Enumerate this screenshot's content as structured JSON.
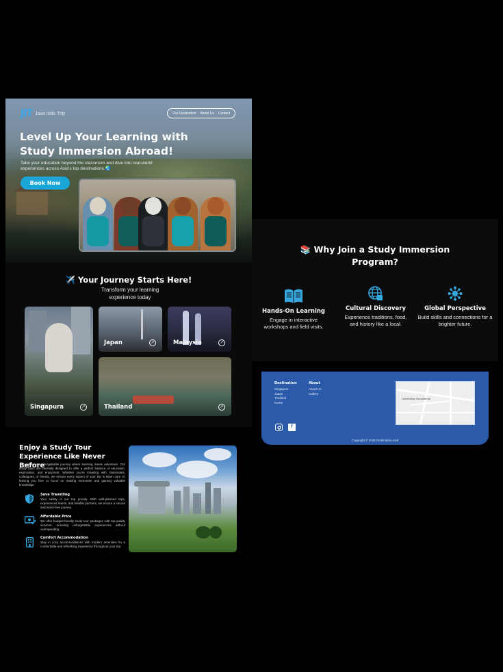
{
  "hero": {
    "logo_mark": "JIT",
    "logo_text": "Java Indo Trip",
    "nav": [
      "Our Destination",
      "About Us",
      "Contact"
    ],
    "title": "Level Up Your Learning with Study Immersion Abroad!",
    "subtitle": "Take your education beyond the classroom and dive into real-world experiences across Asia's top destinations.🌏",
    "cta": "Book Now"
  },
  "journey": {
    "title": "✈️ Your Journey Starts Here!",
    "subtitle": "Transform your learning experience today",
    "destinations": [
      {
        "name": "Singapura",
        "arrow": "↗"
      },
      {
        "name": "Japan",
        "arrow": "↗"
      },
      {
        "name": "Malaysia",
        "arrow": "↗"
      },
      {
        "name": "Thailand",
        "arrow": "↗"
      }
    ]
  },
  "enjoy": {
    "title": "Enjoy a Study Tour Experience Like Never Before",
    "body": "Join us for an unforgettable journey where learning meets adventure. Our study tours are carefully designed to offer a perfect balance of education, exploration, and enjoyment. Whether you're traveling with classmates, colleagues, or friends, we ensure every aspect of your trip is taken care of, leaving you free to focus on making memories and gaining valuable knowledge.",
    "features": [
      {
        "icon": "shield-icon",
        "title": "Save Travelling",
        "desc": "Your safety is our top priority. With well-planned trips, experienced teams, and reliable partners, we ensure a secure and worry-free journey."
      },
      {
        "icon": "price-tag-icon",
        "title": "Affordable Price",
        "desc": "We offer budget-friendly study tour packages with top-quality services, ensuring unforgettable experiences without overspending."
      },
      {
        "icon": "building-icon",
        "title": "Comfort Accommodation",
        "desc": "Stay in cozy accommodations with modern amenities for a comfortable and refreshing experience throughout your trip."
      }
    ]
  },
  "why": {
    "title": "📚 Why Join a Study Immersion Program?",
    "items": [
      {
        "icon": "book-icon",
        "title": "Hands-On Learning",
        "desc": "Engage in interactive workshops and field visits."
      },
      {
        "icon": "globe-icon",
        "title": "Cultural Discovery",
        "desc": "Experience traditions, food, and history like a local."
      },
      {
        "icon": "network-icon",
        "title": "Global Perspective",
        "desc": "Build skills and connections for a brighter future."
      }
    ]
  },
  "footer": {
    "col1_head": "Destination",
    "col1_links": [
      "Singapore",
      "Japan",
      "Thailand",
      "Korea"
    ],
    "col2_head": "About",
    "col2_links": [
      "About Us",
      "Gallery"
    ],
    "map_label": "Universitas Gunadarma",
    "copyright": "Copyright © 2025 Destination Asia"
  },
  "colors": {
    "accent": "#1aa6d6",
    "footer_bg": "#2a5aa9",
    "icon": "#37a7df"
  }
}
